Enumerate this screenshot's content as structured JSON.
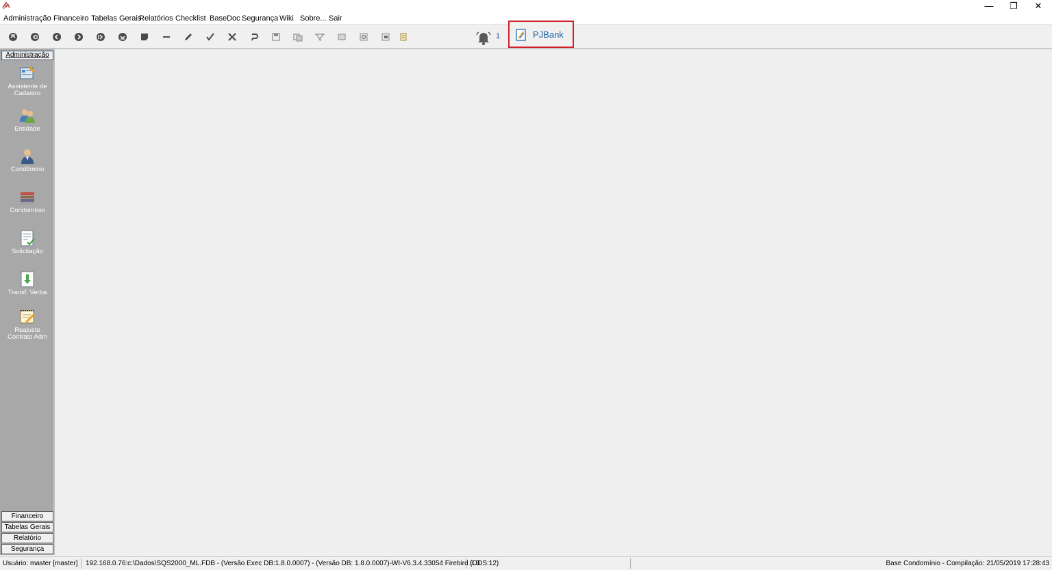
{
  "window": {
    "minimize_glyph": "—",
    "restore_glyph": "❐",
    "close_glyph": "✕"
  },
  "menu": {
    "items": [
      "Administração",
      "Financeiro",
      "Tabelas Gerais",
      "Relatórios",
      "Checklist",
      "BaseDoc",
      "Segurança",
      "Wiki",
      "Sobre...",
      "Sair"
    ]
  },
  "toolbar": {
    "buttons": [
      "first-icon",
      "previous-page-icon",
      "previous-icon",
      "next-icon",
      "next-page-icon",
      "last-icon",
      "insert-icon",
      "delete-icon",
      "edit-icon",
      "confirm-icon",
      "cancel-icon",
      "undo-icon",
      "save-icon",
      "copy-icon",
      "filter-icon",
      "print-icon",
      "preview-icon",
      "export-icon",
      "report-icon"
    ],
    "notification_count": "1",
    "pjbank_label": "PJBank"
  },
  "left_panel": {
    "header": "Administração",
    "items": [
      {
        "label": "Assistente de Cadastro",
        "icon": "wizard-icon"
      },
      {
        "label": "Entidade",
        "icon": "entity-icon"
      },
      {
        "label": "Condômino",
        "icon": "person-icon"
      },
      {
        "label": "Condomínio",
        "icon": "buildings-icon"
      },
      {
        "label": "Solicitação",
        "icon": "request-icon"
      },
      {
        "label": "Transf. Verba",
        "icon": "transfer-icon"
      },
      {
        "label": "Reajuste Contrato Adm",
        "icon": "contract-icon"
      }
    ],
    "bottom_tabs": [
      "Financeiro",
      "Tabelas Gerais",
      "Relatório",
      "Segurança"
    ]
  },
  "status": {
    "user": "Usuário: master [master]",
    "connection": "192.168.0.76:c:\\Dados\\SQS2000_ML.FDB - (Versão Exec DB:1.8.0.0007) - (Versão DB: 1.8.0.0007)-WI-V6.3.4.33054 Firebird 3.0",
    "ods": "(ODS:12)",
    "build": "Base Condomínio - Compilação: 21/05/2019 17:28:43"
  },
  "colors": {
    "highlight_border": "#d0212a",
    "pjbank_text": "#1a5fa8",
    "panel_bg": "#a8a8a8"
  }
}
